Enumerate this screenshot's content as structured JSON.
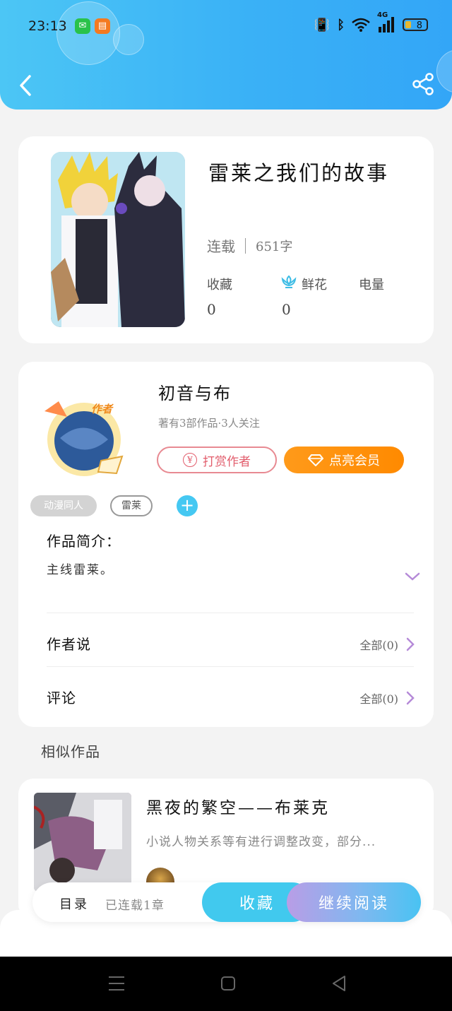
{
  "status_bar": {
    "time": "23:13",
    "battery": "8",
    "network": "4G"
  },
  "book": {
    "title": "雷莱之我们的故事",
    "status": "连载",
    "word_count": "651字",
    "stats": [
      {
        "label": "收藏",
        "value": "0"
      },
      {
        "label": "鲜花",
        "value": "0"
      },
      {
        "label": "电量",
        "value": ""
      }
    ]
  },
  "author": {
    "badge": "作者",
    "name": "初音与布",
    "stats": "著有3部作品·3人关注",
    "tip_button": "打赏作者",
    "vip_button": "点亮会员"
  },
  "tags": [
    "动漫同人",
    "雷莱"
  ],
  "intro": {
    "heading": "作品简介：",
    "text": "主线雷莱。"
  },
  "author_says": {
    "heading": "作者说",
    "all_label": "全部(0)"
  },
  "comments": {
    "heading": "评论",
    "all_label": "全部(0)"
  },
  "similar": {
    "heading": "相似作品",
    "items": [
      {
        "title": "黑夜的繁空——布莱克",
        "desc": "小说人物关系等有进行调整改变，部分..."
      }
    ]
  },
  "bottom_bar": {
    "toc_label": "目录",
    "chapter_count": "已连载1章",
    "collect_label": "收藏",
    "read_label": "继续阅读"
  },
  "colors": {
    "header": "#3ab1f6",
    "accent_cyan": "#45c8f2",
    "vip_orange": "#ff9a1a",
    "tip_red": "#e25d6c"
  }
}
